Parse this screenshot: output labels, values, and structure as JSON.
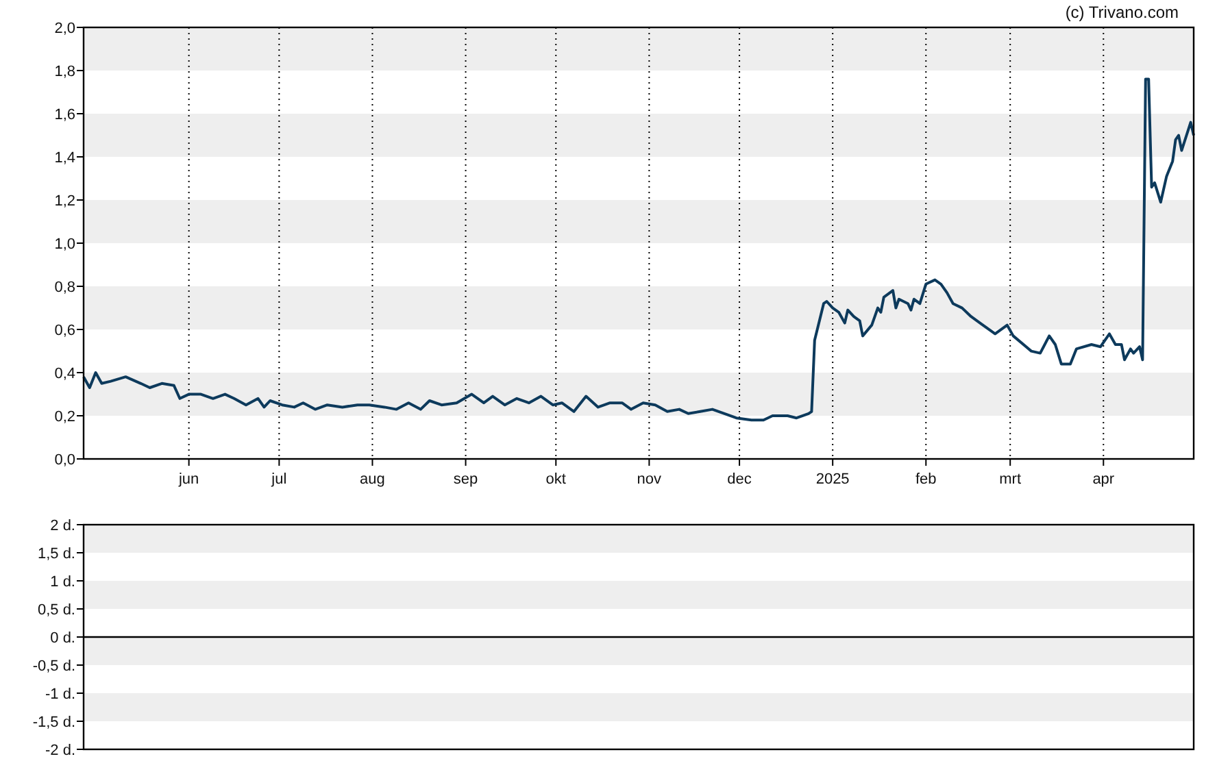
{
  "copyright": "(c) Trivano.com",
  "price_chart": {
    "chart_data": {
      "type": "line",
      "grid": true,
      "xlim": [
        "2024-04-27",
        "2025-05-01"
      ],
      "ylim": [
        0,
        2
      ],
      "xticks": [
        {
          "value": "2024-06-01",
          "label": "jun"
        },
        {
          "value": "2024-07-01",
          "label": "jul"
        },
        {
          "value": "2024-08-01",
          "label": "aug"
        },
        {
          "value": "2024-09-01",
          "label": "sep"
        },
        {
          "value": "2024-10-01",
          "label": "okt"
        },
        {
          "value": "2024-11-01",
          "label": "nov"
        },
        {
          "value": "2024-12-01",
          "label": "dec"
        },
        {
          "value": "2025-01-01",
          "label": "2025"
        },
        {
          "value": "2025-02-01",
          "label": "feb"
        },
        {
          "value": "2025-03-01",
          "label": "mrt"
        },
        {
          "value": "2025-04-01",
          "label": "apr"
        }
      ],
      "yticks": [
        {
          "value": 0,
          "label": "0,0"
        },
        {
          "value": 0.2,
          "label": "0,2"
        },
        {
          "value": 0.4,
          "label": "0,4"
        },
        {
          "value": 0.6,
          "label": "0,6"
        },
        {
          "value": 0.8,
          "label": "0,8"
        },
        {
          "value": 1,
          "label": "1,0"
        },
        {
          "value": 1.2,
          "label": "1,2"
        },
        {
          "value": 1.4,
          "label": "1,4"
        },
        {
          "value": 1.6,
          "label": "1,6"
        },
        {
          "value": 1.8,
          "label": "1,8"
        },
        {
          "value": 2,
          "label": "2,0"
        }
      ],
      "x": [
        "2024-04-27",
        "2024-04-29",
        "2024-05-01",
        "2024-05-03",
        "2024-05-06",
        "2024-05-11",
        "2024-05-16",
        "2024-05-19",
        "2024-05-23",
        "2024-05-27",
        "2024-05-29",
        "2024-06-01",
        "2024-06-05",
        "2024-06-09",
        "2024-06-13",
        "2024-06-16",
        "2024-06-20",
        "2024-06-24",
        "2024-06-26",
        "2024-06-28",
        "2024-07-02",
        "2024-07-06",
        "2024-07-09",
        "2024-07-13",
        "2024-07-17",
        "2024-07-22",
        "2024-07-27",
        "2024-07-31",
        "2024-08-05",
        "2024-08-09",
        "2024-08-13",
        "2024-08-17",
        "2024-08-20",
        "2024-08-24",
        "2024-08-29",
        "2024-09-03",
        "2024-09-07",
        "2024-09-10",
        "2024-09-14",
        "2024-09-18",
        "2024-09-22",
        "2024-09-26",
        "2024-09-30",
        "2024-10-03",
        "2024-10-07",
        "2024-10-11",
        "2024-10-15",
        "2024-10-19",
        "2024-10-23",
        "2024-10-26",
        "2024-10-30",
        "2024-11-03",
        "2024-11-07",
        "2024-11-11",
        "2024-11-14",
        "2024-11-18",
        "2024-11-22",
        "2024-11-26",
        "2024-11-30",
        "2024-12-05",
        "2024-12-09",
        "2024-12-12",
        "2024-12-17",
        "2024-12-20",
        "2024-12-24",
        "2024-12-25",
        "2024-12-26",
        "2024-12-29",
        "2024-12-30",
        "2025-01-01",
        "2025-01-03",
        "2025-01-05",
        "2025-01-06",
        "2025-01-08",
        "2025-01-10",
        "2025-01-11",
        "2025-01-14",
        "2025-01-16",
        "2025-01-17",
        "2025-01-18",
        "2025-01-21",
        "2025-01-22",
        "2025-01-23",
        "2025-01-26",
        "2025-01-27",
        "2025-01-28",
        "2025-01-30",
        "2025-02-01",
        "2025-02-04",
        "2025-02-06",
        "2025-02-08",
        "2025-02-10",
        "2025-02-13",
        "2025-02-16",
        "2025-02-19",
        "2025-02-24",
        "2025-02-28",
        "2025-03-02",
        "2025-03-08",
        "2025-03-11",
        "2025-03-14",
        "2025-03-16",
        "2025-03-18",
        "2025-03-21",
        "2025-03-23",
        "2025-03-28",
        "2025-03-31",
        "2025-04-03",
        "2025-04-05",
        "2025-04-07",
        "2025-04-08",
        "2025-04-10",
        "2025-04-11",
        "2025-04-13",
        "2025-04-14",
        "2025-04-15",
        "2025-04-16",
        "2025-04-17",
        "2025-04-18",
        "2025-04-20",
        "2025-04-22",
        "2025-04-24",
        "2025-04-25",
        "2025-04-26",
        "2025-04-27",
        "2025-04-30",
        "2025-05-01"
      ],
      "series": [
        {
          "color": "#0d3a5c",
          "values": [
            0.38,
            0.33,
            0.4,
            0.35,
            0.36,
            0.38,
            0.35,
            0.33,
            0.35,
            0.34,
            0.28,
            0.3,
            0.3,
            0.28,
            0.3,
            0.28,
            0.25,
            0.28,
            0.24,
            0.27,
            0.25,
            0.24,
            0.26,
            0.23,
            0.25,
            0.24,
            0.25,
            0.25,
            0.24,
            0.23,
            0.26,
            0.23,
            0.27,
            0.25,
            0.26,
            0.3,
            0.26,
            0.29,
            0.25,
            0.28,
            0.26,
            0.29,
            0.25,
            0.26,
            0.22,
            0.29,
            0.24,
            0.26,
            0.26,
            0.23,
            0.26,
            0.25,
            0.22,
            0.23,
            0.21,
            0.22,
            0.23,
            0.21,
            0.19,
            0.18,
            0.18,
            0.2,
            0.2,
            0.19,
            0.21,
            0.22,
            0.55,
            0.72,
            0.73,
            0.7,
            0.68,
            0.63,
            0.69,
            0.66,
            0.64,
            0.57,
            0.62,
            0.7,
            0.68,
            0.75,
            0.78,
            0.7,
            0.74,
            0.72,
            0.69,
            0.74,
            0.72,
            0.81,
            0.83,
            0.81,
            0.77,
            0.72,
            0.7,
            0.66,
            0.63,
            0.58,
            0.62,
            0.57,
            0.5,
            0.49,
            0.57,
            0.53,
            0.44,
            0.44,
            0.51,
            0.53,
            0.52,
            0.58,
            0.53,
            0.53,
            0.46,
            0.51,
            0.49,
            0.52,
            0.46,
            1.76,
            1.76,
            1.26,
            1.28,
            1.19,
            1.31,
            1.38,
            1.48,
            1.5,
            1.43,
            1.56,
            1.5
          ]
        }
      ]
    }
  },
  "lower_panel": {
    "y_labels": [
      "2 d.",
      "1,5 d.",
      "1 d.",
      "0,5 d.",
      "0 d.",
      "-0,5 d.",
      "-1 d.",
      "-1,5 d.",
      "-2 d."
    ]
  }
}
